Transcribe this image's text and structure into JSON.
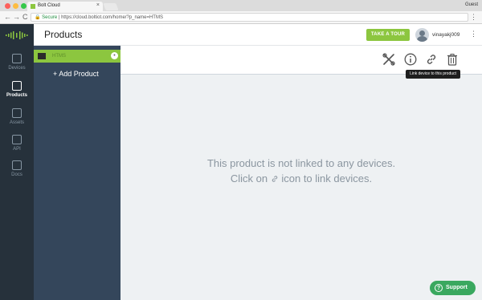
{
  "browser": {
    "tab_title": "Bolt Cloud",
    "tab_close": "×",
    "guest_label": "Guest",
    "secure_label": "Secure",
    "url": "https://cloud.boltiot.com/home/?p_name=HTMS",
    "nav_back": "←",
    "nav_forward": "→",
    "nav_reload": "C",
    "menu": "⋮"
  },
  "header": {
    "page_title": "Products",
    "tour_button": "TAKE A TOUR",
    "username": "vinayakj009",
    "kebab": "⋮"
  },
  "sidebar": {
    "items": [
      {
        "label": "Devices",
        "icon": "devices-icon"
      },
      {
        "label": "Products",
        "icon": "products-icon"
      },
      {
        "label": "Assets",
        "icon": "assets-icon"
      },
      {
        "label": "API",
        "icon": "api-icon"
      },
      {
        "label": "Docs",
        "icon": "docs-icon"
      }
    ]
  },
  "products": {
    "selected_name": "HTMS",
    "add_label": "+ Add Product"
  },
  "toolbar": {
    "tooltip": "Link device to this product"
  },
  "main": {
    "empty_line1": "This product is not linked to any devices.",
    "empty_line2_before": "Click on ",
    "empty_line2_after": " icon to link devices."
  },
  "support": {
    "label": "Support",
    "qmark": "?"
  },
  "colors": {
    "accent_green": "#8cc63f",
    "sidebar_dark": "#26313b",
    "panel_blue": "#34465b",
    "support_green": "#3aa85f"
  }
}
